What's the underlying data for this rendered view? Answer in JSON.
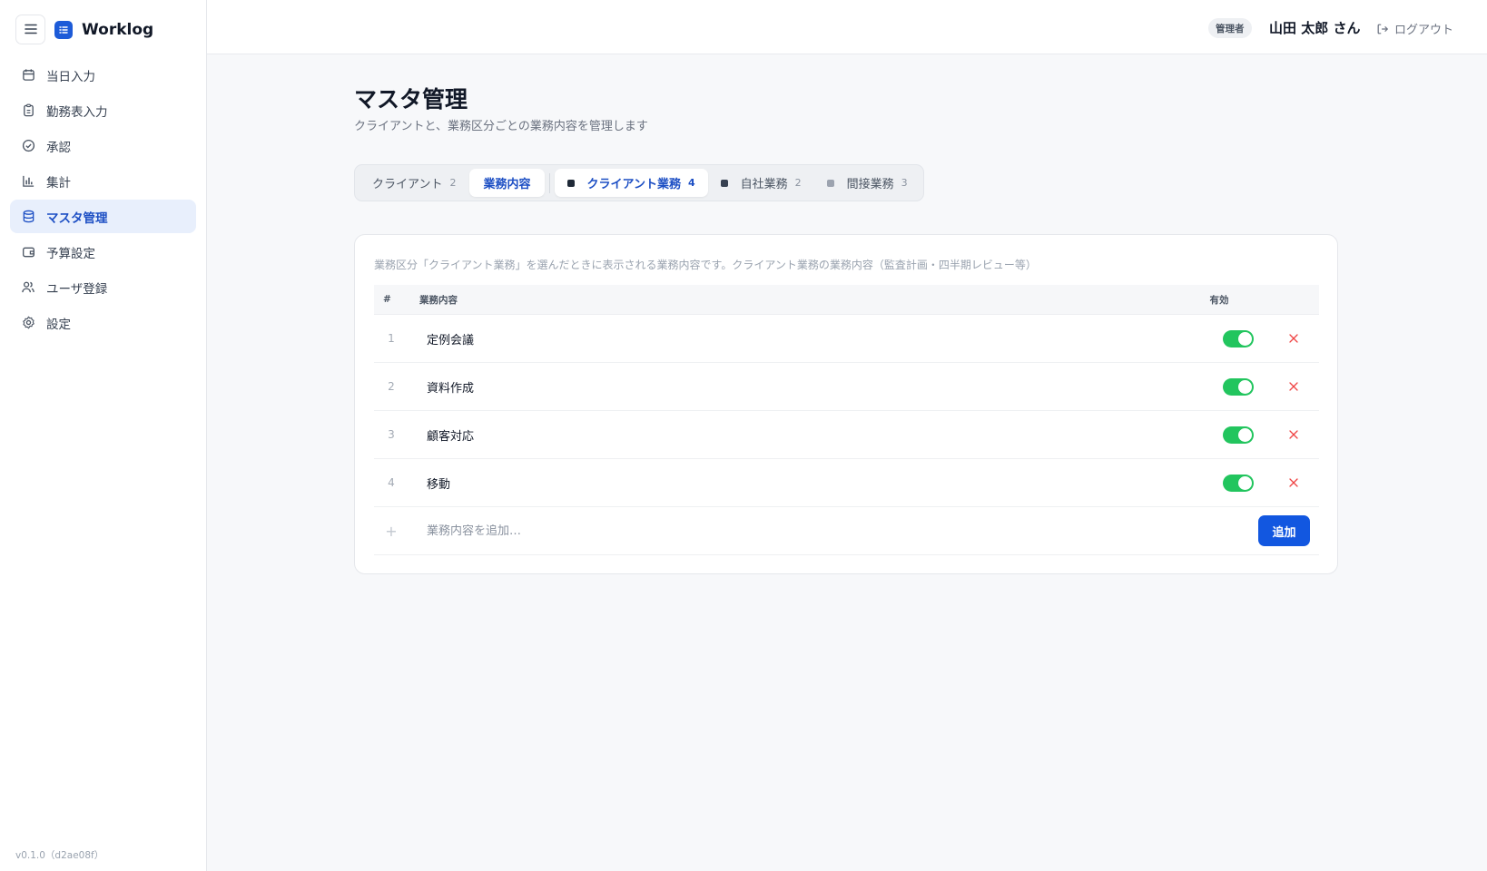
{
  "app": {
    "name": "Worklog",
    "version": "v0.1.0（d2ae08f）"
  },
  "sidebar": {
    "items": [
      {
        "label": "当日入力",
        "icon": "calendar-icon"
      },
      {
        "label": "勤務表入力",
        "icon": "clipboard-icon"
      },
      {
        "label": "承認",
        "icon": "check-circle-icon"
      },
      {
        "label": "集計",
        "icon": "bar-chart-icon"
      },
      {
        "label": "マスタ管理",
        "icon": "database-icon",
        "active": true
      },
      {
        "label": "予算設定",
        "icon": "wallet-icon"
      },
      {
        "label": "ユーザ登録",
        "icon": "users-icon"
      },
      {
        "label": "設定",
        "icon": "settings-icon"
      }
    ]
  },
  "header": {
    "role": "管理者",
    "user": "山田 太郎 さん",
    "logout": "ログアウト"
  },
  "page": {
    "title": "マスタ管理",
    "subtitle": "クライアントと、業務区分ごとの業務内容を管理します"
  },
  "tabs": [
    {
      "label": "クライアント",
      "count": "2",
      "selected": false
    },
    {
      "label": "業務内容",
      "count": "",
      "selected": true
    }
  ],
  "subtabs": [
    {
      "label": "クライアント業務",
      "count": "4",
      "dot_color": "#1f2937",
      "selected": true
    },
    {
      "label": "自社業務",
      "count": "2",
      "dot_color": "#374151",
      "selected": false
    },
    {
      "label": "間接業務",
      "count": "3",
      "dot_color": "#9ca3af",
      "selected": false
    }
  ],
  "card": {
    "description": "業務区分「クライアント業務」を選んだときに表示される業務内容です。クライアント業務の業務内容（監査計画・四半期レビュー等）",
    "columns": {
      "no": "#",
      "name": "業務内容",
      "active": "有効"
    },
    "rows": [
      {
        "no": "1",
        "name": "定例会議",
        "active": true
      },
      {
        "no": "2",
        "name": "資料作成",
        "active": true
      },
      {
        "no": "3",
        "name": "顧客対応",
        "active": true
      },
      {
        "no": "4",
        "name": "移動",
        "active": true
      }
    ],
    "add": {
      "placeholder": "業務内容を追加…",
      "button": "追加"
    }
  },
  "colors": {
    "accent": "#1257e0",
    "active_nav_bg": "#e8effc",
    "toggle_on": "#22c55e",
    "delete": "#ef4444"
  }
}
